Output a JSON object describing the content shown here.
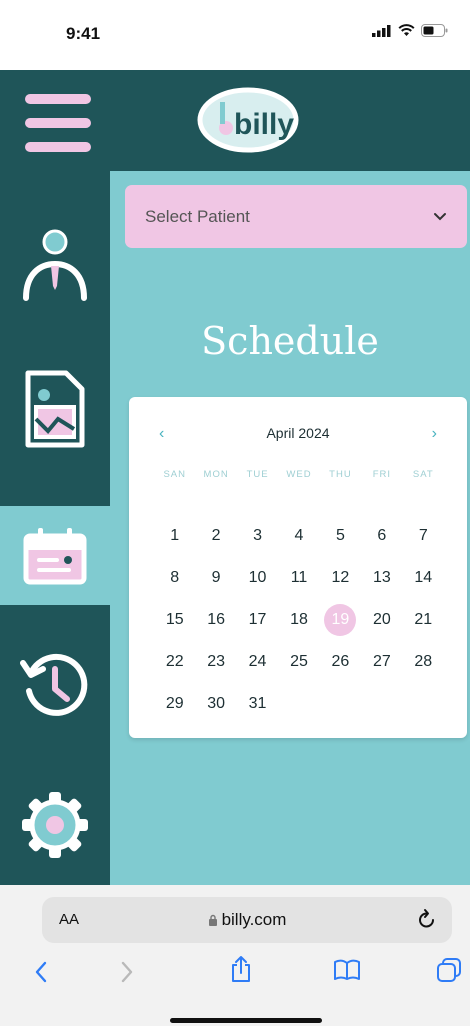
{
  "status_bar": {
    "time": "9:41"
  },
  "header": {
    "logo_text": "billy"
  },
  "sidebar": {
    "items": [
      {
        "name": "profile"
      },
      {
        "name": "reports"
      },
      {
        "name": "schedule",
        "active": true
      },
      {
        "name": "history"
      },
      {
        "name": "settings"
      }
    ]
  },
  "patient_select": {
    "label": "Select Patient"
  },
  "page": {
    "title": "Schedule"
  },
  "calendar": {
    "month_label": "April 2024",
    "prev_icon": "chevron-left-icon",
    "next_icon": "chevron-right-icon",
    "weekdays": [
      "SAN",
      "MON",
      "TUE",
      "WED",
      "THU",
      "FRI",
      "SAT"
    ],
    "leading_blanks": 0,
    "days": [
      "1",
      "2",
      "3",
      "4",
      "5",
      "6",
      "7",
      "8",
      "9",
      "10",
      "11",
      "12",
      "13",
      "14",
      "15",
      "16",
      "17",
      "18",
      "19",
      "20",
      "21",
      "22",
      "23",
      "24",
      "25",
      "26",
      "27",
      "28",
      "29",
      "30",
      "31"
    ],
    "selected_day": "19"
  },
  "browser": {
    "aa_label": "AA",
    "url": "billy.com"
  },
  "colors": {
    "dark_teal": "#1f5559",
    "light_teal": "#80cbd0",
    "pink": "#f0c6e4",
    "accent_blue": "#4ab4c0"
  }
}
